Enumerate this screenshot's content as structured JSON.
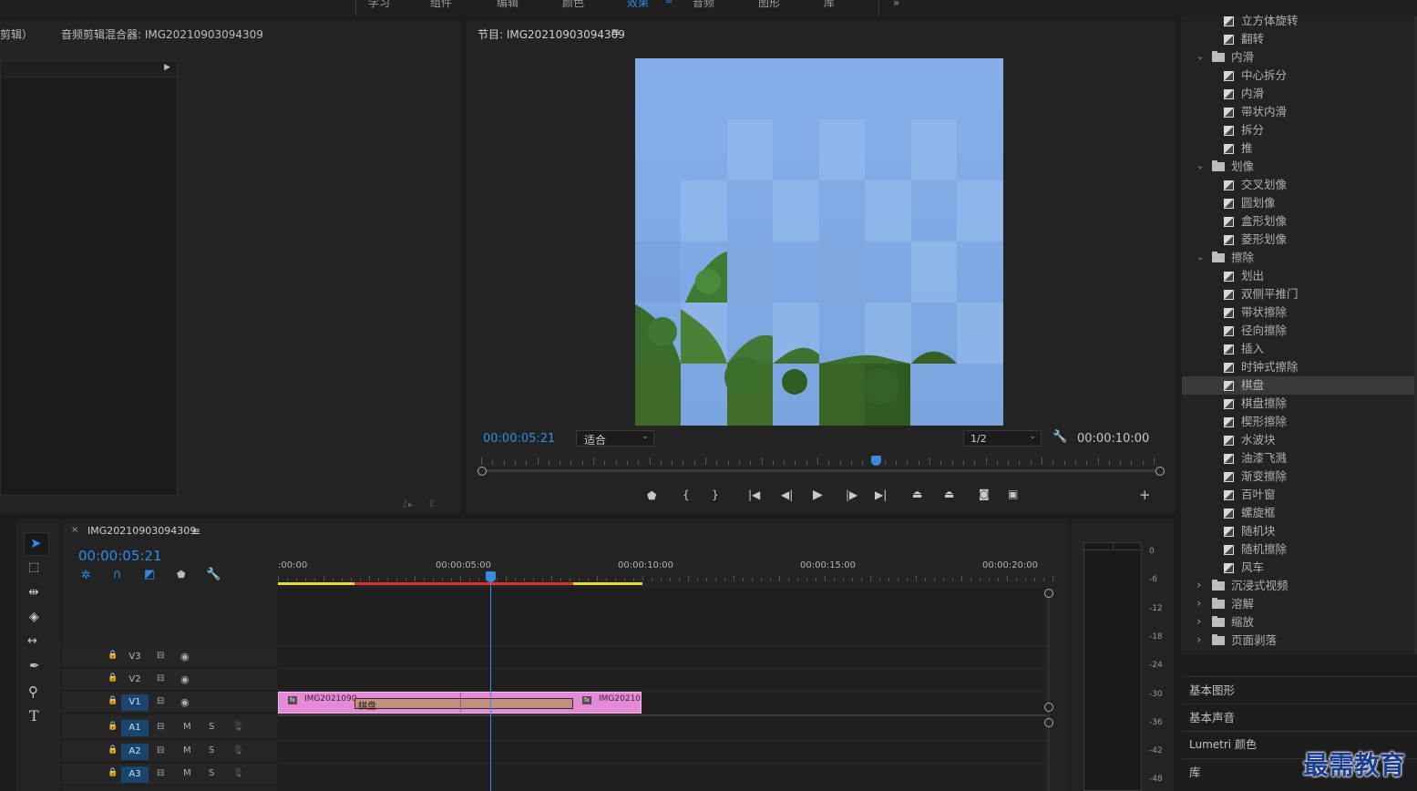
{
  "topbar": {
    "workspaces": [
      "学习",
      "组件",
      "编辑",
      "颜色",
      "效果",
      "音频",
      "图形",
      "库"
    ],
    "active_workspace": "效果",
    "more": "»"
  },
  "source_panel": {
    "tab_partial": "剪辑）",
    "mixer_title": "音频剪辑混合器: IMG20210903094309"
  },
  "program": {
    "title": "节目: IMG20210903094309",
    "menu": "≡",
    "timecode": "00:00:05:21",
    "fit": "适合",
    "resolution": "1/2",
    "duration": "00:00:10:00",
    "playhead_fraction": 0.58
  },
  "effects": {
    "rows": [
      {
        "type": "item",
        "label": "立方体旋转"
      },
      {
        "type": "item",
        "label": "翻转"
      },
      {
        "type": "folder",
        "label": "内滑",
        "open": true
      },
      {
        "type": "item",
        "label": "中心拆分"
      },
      {
        "type": "item",
        "label": "内滑"
      },
      {
        "type": "item",
        "label": "带状内滑"
      },
      {
        "type": "item",
        "label": "拆分"
      },
      {
        "type": "item",
        "label": "推"
      },
      {
        "type": "folder",
        "label": "划像",
        "open": true
      },
      {
        "type": "item",
        "label": "交叉划像"
      },
      {
        "type": "item",
        "label": "圆划像"
      },
      {
        "type": "item",
        "label": "盒形划像"
      },
      {
        "type": "item",
        "label": "菱形划像"
      },
      {
        "type": "folder",
        "label": "擦除",
        "open": true
      },
      {
        "type": "item",
        "label": "划出"
      },
      {
        "type": "item",
        "label": "双侧平推门"
      },
      {
        "type": "item",
        "label": "带状擦除"
      },
      {
        "type": "item",
        "label": "径向擦除"
      },
      {
        "type": "item",
        "label": "插入"
      },
      {
        "type": "item",
        "label": "时钟式擦除"
      },
      {
        "type": "item",
        "label": "棋盘",
        "selected": true
      },
      {
        "type": "item",
        "label": "棋盘擦除"
      },
      {
        "type": "item",
        "label": "楔形擦除"
      },
      {
        "type": "item",
        "label": "水波块"
      },
      {
        "type": "item",
        "label": "油漆飞溅"
      },
      {
        "type": "item",
        "label": "渐变擦除"
      },
      {
        "type": "item",
        "label": "百叶窗"
      },
      {
        "type": "item",
        "label": "螺旋框"
      },
      {
        "type": "item",
        "label": "随机块"
      },
      {
        "type": "item",
        "label": "随机擦除"
      },
      {
        "type": "item",
        "label": "风车"
      },
      {
        "type": "folder",
        "label": "沉浸式视频",
        "open": false
      },
      {
        "type": "folder",
        "label": "溶解",
        "open": false
      },
      {
        "type": "folder",
        "label": "缩放",
        "open": false
      },
      {
        "type": "folder",
        "label": "页面剥落",
        "open": false
      }
    ]
  },
  "panels_list": [
    "基本图形",
    "基本声音",
    "Lumetri 颜色",
    "库"
  ],
  "watermark": "最需教育",
  "timeline": {
    "close": "×",
    "sequence": "IMG20210903094309",
    "menu": "≡",
    "timecode": "00:00:05:21",
    "ruler": [
      ":00:00",
      "00:00:05:00",
      "00:00:10:00",
      "00:00:15:00",
      "00:00:20:00"
    ],
    "tracks": [
      {
        "name": "V3",
        "kind": "video",
        "on": false
      },
      {
        "name": "V2",
        "kind": "video",
        "on": false
      },
      {
        "name": "V1",
        "kind": "video",
        "on": true
      },
      {
        "name": "A1",
        "kind": "audio",
        "on": true
      },
      {
        "name": "A2",
        "kind": "audio",
        "on": true
      },
      {
        "name": "A3",
        "kind": "audio",
        "on": true
      }
    ],
    "clip_left_label": "IMG2021090",
    "transition_label": "棋盘",
    "clip_right_label": "IMG20210",
    "fx_badge": "fx",
    "mute": "M",
    "solo": "S"
  },
  "meter": {
    "scale": [
      "0",
      "-6",
      "-12",
      "-18",
      "-24",
      "-30",
      "-36",
      "-42",
      "-48"
    ]
  },
  "colors": {
    "accent": "#2d8ceb",
    "clip": "#e58ad6",
    "transition": "#c09080",
    "track_on": "#19456e",
    "playhead": "#3b8ae0",
    "work_red": "#e03030",
    "work_yellow": "#e6e033",
    "sky": "#7fa9e4"
  }
}
